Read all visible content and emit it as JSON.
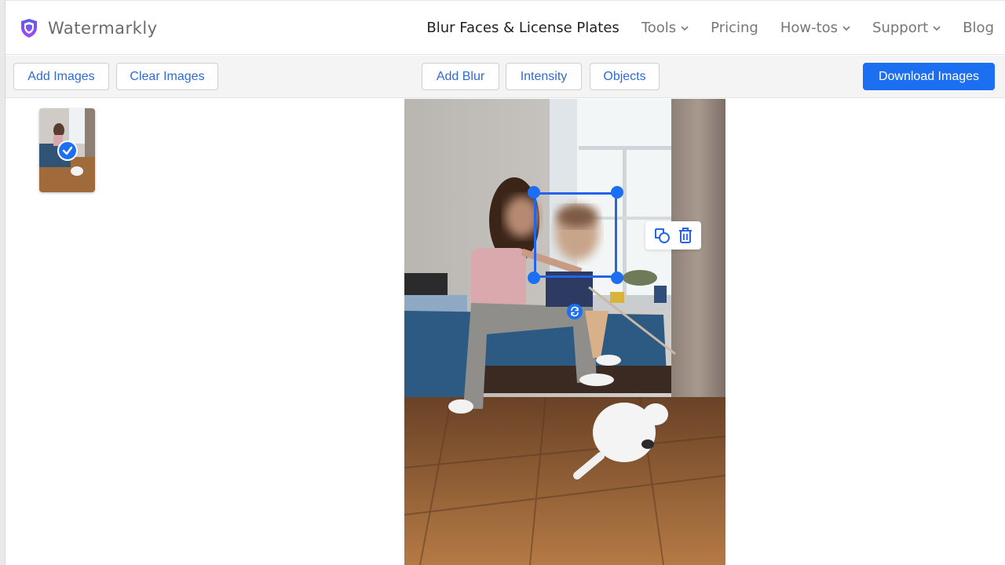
{
  "app": {
    "name": "Watermarkly",
    "brand_color": "#7c3aed",
    "accent_color": "#1d6ff2"
  },
  "header": {
    "nav": [
      {
        "label": "Blur Faces & License Plates",
        "active": true,
        "dropdown": false
      },
      {
        "label": "Tools",
        "active": false,
        "dropdown": true
      },
      {
        "label": "Pricing",
        "active": false,
        "dropdown": false
      },
      {
        "label": "How-tos",
        "active": false,
        "dropdown": true
      },
      {
        "label": "Support",
        "active": false,
        "dropdown": true
      },
      {
        "label": "Blog",
        "active": false,
        "dropdown": false
      }
    ]
  },
  "toolbar": {
    "add_images": "Add Images",
    "clear_images": "Clear Images",
    "add_blur": "Add Blur",
    "intensity": "Intensity",
    "objects": "Objects",
    "download_images": "Download Images"
  },
  "thumbnails": [
    {
      "description": "Girl and child on bed with white cat",
      "selected": true
    }
  ],
  "editor": {
    "image_description": "Girl sitting on bed playing with white cat on wooden floor",
    "blur_regions": [
      {
        "label": "face blur region",
        "selected": true
      }
    ],
    "context_menu": {
      "icons": [
        "shapes-icon",
        "trash-icon"
      ]
    }
  }
}
